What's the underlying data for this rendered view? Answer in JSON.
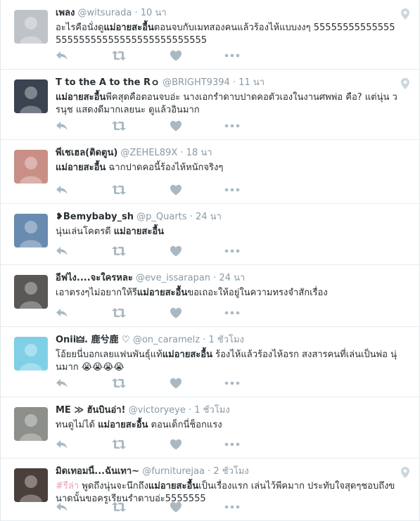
{
  "colors": {
    "muted": "#8899a6",
    "text": "#292f33",
    "hashtag": "#e8a0b8",
    "icon": "#aab8c2"
  },
  "tweets": [
    {
      "name": "เพลง",
      "handle": "@witsurada",
      "time": "· 10 นา",
      "pre": "อะไรคือนั่งดู",
      "bold": "แม่อายสะอื้น",
      "post": "ตอนจบกับเมทสองคนแล้วร้องไห้แบบงงๆ 5555555555555555555555555555555555555555",
      "geo": true,
      "avatar_color": "#bfc3c7"
    },
    {
      "name": "T to the A to the Rｏ",
      "handle": "@BRIGHT9394",
      "time": "· 11 นา",
      "pre": "",
      "bold": "แม่อายสะอื้น",
      "post": "พีคสุดคือตอนจบอ่ะ นางเอกรำดาบปาดคอตัวเองในงานศพพ่อ คือ? แต่นุ่น วรนุช แสดงดีมากเลยนะ ดูแล้วอินมาก",
      "geo": true,
      "avatar_color": "#3b4250"
    },
    {
      "name": "พี่เชเฮล(ติดตูน)",
      "handle": "@ZEHEL89X",
      "time": "· 18 นา",
      "pre": "",
      "bold": "แม่อายสะอื้น",
      "post": " ฉากปาดคอนี้ร้องไห้หนักจริงๆ",
      "geo": false,
      "avatar_color": "#c98f86"
    },
    {
      "name": "❥Bemybaby_sh",
      "handle": "@p_Quarts",
      "time": "· 24 นา",
      "pre": "นุ่นเล่นโคตรดี ",
      "bold": "แม่อายสะอื้น",
      "post": "",
      "geo": false,
      "avatar_color": "#6a8bb0"
    },
    {
      "name": "อีฟไง....จะใครหละ",
      "handle": "@eve_issarapan",
      "time": "· 24 นา",
      "pre": "เอาตรงๆไม่อยากให้รี",
      "bold": "แม่อายสะอื้น",
      "post": "ขอเถอะให้อยู่ในความทรงจำสักเรื่อง",
      "geo": false,
      "avatar_color": "#5a5754"
    },
    {
      "name": "Onii🜲. 鹿兮鹿 ♡",
      "handle": "@on_caramelz",
      "time": "· 1 ชั่วโมง",
      "pre": "โอ้ยยนี่บอกเลยแฟนพันธุ์แท้",
      "bold": "แม่อายสะอื้น",
      "post": " ร้องไห้แล้วร้องไห้อรก สงสารคนที่เล่นเป็นพ่อ นุ่นมาก 😭😭😭😭",
      "geo": false,
      "avatar_color": "#7fd0e6"
    },
    {
      "name": "ME ≫ ฮันบินอ่า!",
      "handle": "@victoryeye",
      "time": "· 1 ชั่วโมง",
      "pre": "ทนดูไม่ได้ ",
      "bold": "แม่อายสะอื้น",
      "post": " ตอนเด็กนี่ช็อกแรง",
      "geo": false,
      "avatar_color": "#8c8f8a"
    },
    {
      "name": "มิดเทอมนี้...ฉันเทา~",
      "handle": "@furniturejaa",
      "time": "· 2 ชั่วโมง",
      "hashtag": "#รีล่า",
      "pre": " พูดถึงนุ่นจะนึกถึง",
      "bold": "แม่อายสะอื้น",
      "post": "เป็นเรื่องแรก เล่นไว้พีคมาก ประทับใจสุดๆชอบถึงขนาดนั้นขอครูเรียนรำดาบอ่ะ5555555",
      "geo": true,
      "avatar_color": "#4a3f3a"
    }
  ]
}
